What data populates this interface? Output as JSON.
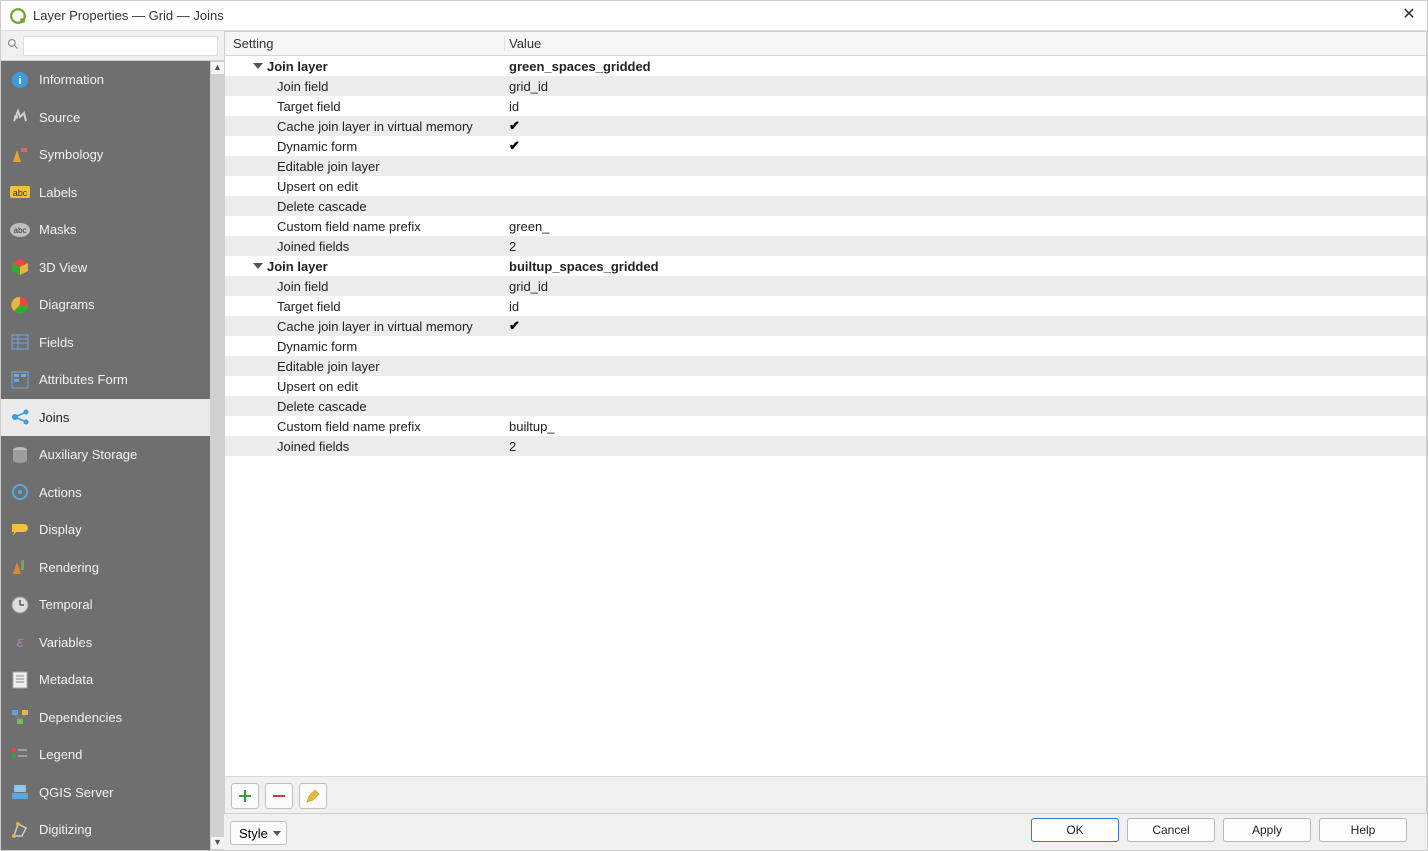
{
  "window": {
    "title": "Layer Properties — Grid — Joins"
  },
  "search": {
    "placeholder": ""
  },
  "sidebar": {
    "items": [
      {
        "label": "Information"
      },
      {
        "label": "Source"
      },
      {
        "label": "Symbology"
      },
      {
        "label": "Labels"
      },
      {
        "label": "Masks"
      },
      {
        "label": "3D View"
      },
      {
        "label": "Diagrams"
      },
      {
        "label": "Fields"
      },
      {
        "label": "Attributes Form"
      },
      {
        "label": "Joins"
      },
      {
        "label": "Auxiliary Storage"
      },
      {
        "label": "Actions"
      },
      {
        "label": "Display"
      },
      {
        "label": "Rendering"
      },
      {
        "label": "Temporal"
      },
      {
        "label": "Variables"
      },
      {
        "label": "Metadata"
      },
      {
        "label": "Dependencies"
      },
      {
        "label": "Legend"
      },
      {
        "label": "QGIS Server"
      },
      {
        "label": "Digitizing"
      }
    ],
    "selected_index": 9
  },
  "columns": {
    "setting": "Setting",
    "value": "Value"
  },
  "joins": [
    {
      "header": "Join layer",
      "layer": "green_spaces_gridded",
      "rows": [
        {
          "k": "Join field",
          "v": "grid_id"
        },
        {
          "k": "Target field",
          "v": "id"
        },
        {
          "k": "Cache join layer in virtual memory",
          "v": "✔"
        },
        {
          "k": "Dynamic form",
          "v": "✔"
        },
        {
          "k": "Editable join layer",
          "v": ""
        },
        {
          "k": "Upsert on edit",
          "v": ""
        },
        {
          "k": "Delete cascade",
          "v": ""
        },
        {
          "k": "Custom field name prefix",
          "v": "green_"
        },
        {
          "k": "Joined fields",
          "v": "2"
        }
      ]
    },
    {
      "header": "Join layer",
      "layer": "builtup_spaces_gridded",
      "rows": [
        {
          "k": "Join field",
          "v": "grid_id"
        },
        {
          "k": "Target field",
          "v": "id"
        },
        {
          "k": "Cache join layer in virtual memory",
          "v": "✔"
        },
        {
          "k": "Dynamic form",
          "v": ""
        },
        {
          "k": "Editable join layer",
          "v": ""
        },
        {
          "k": "Upsert on edit",
          "v": ""
        },
        {
          "k": "Delete cascade",
          "v": ""
        },
        {
          "k": "Custom field name prefix",
          "v": "builtup_"
        },
        {
          "k": "Joined fields",
          "v": "2"
        }
      ]
    }
  ],
  "style_button": "Style",
  "buttons": {
    "ok": "OK",
    "cancel": "Cancel",
    "apply": "Apply",
    "help": "Help"
  }
}
